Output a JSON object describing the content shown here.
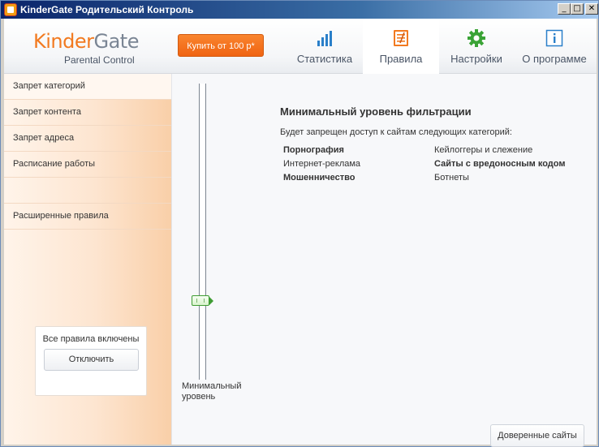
{
  "window": {
    "title": "KinderGate Родительский Контроль",
    "buttons": {
      "minimize": "_",
      "maximize": "□",
      "close": "✕"
    }
  },
  "header": {
    "logo_kinder": "Kinder",
    "logo_gate": "Gate",
    "logo_sub": "Parental Control",
    "buy_label": "Купить от 100 р*",
    "tabs": [
      {
        "label": "Статистика",
        "icon": "chart-bars-icon"
      },
      {
        "label": "Правила",
        "icon": "rules-list-icon",
        "active": true
      },
      {
        "label": "Настройки",
        "icon": "gear-icon"
      },
      {
        "label": "О программе",
        "icon": "info-icon"
      }
    ]
  },
  "sidebar": {
    "items": [
      {
        "label": "Запрет категорий"
      },
      {
        "label": "Запрет контента"
      },
      {
        "label": "Запрет адреса"
      },
      {
        "label": "Расписание работы"
      },
      {
        "label": ""
      },
      {
        "label": "Расширенные правила"
      }
    ],
    "status_text": "Все правила включены",
    "disable_label": "Отключить"
  },
  "main": {
    "slider_label_line1": "Минимальный",
    "slider_label_line2": "уровень",
    "level_title": "Минимальный уровень фильтрации",
    "level_desc": "Будет запрещен доступ к сайтам следующих категорий:",
    "categories_left": [
      {
        "label": "Порнография",
        "bold": true
      },
      {
        "label": "Интернет-реклама",
        "bold": false
      },
      {
        "label": "Мошенничество",
        "bold": true
      }
    ],
    "categories_right": [
      {
        "label": "Кейлоггеры и слежение",
        "bold": false
      },
      {
        "label": "Сайты с вредоносным кодом",
        "bold": true
      },
      {
        "label": "Ботнеты",
        "bold": false
      }
    ],
    "trusted_label": "Доверенные сайты"
  },
  "colors": {
    "accent_orange": "#f27a20",
    "icon_blue": "#2a7fc9",
    "icon_green": "#3aa336",
    "slider_green": "#3f9c33"
  }
}
